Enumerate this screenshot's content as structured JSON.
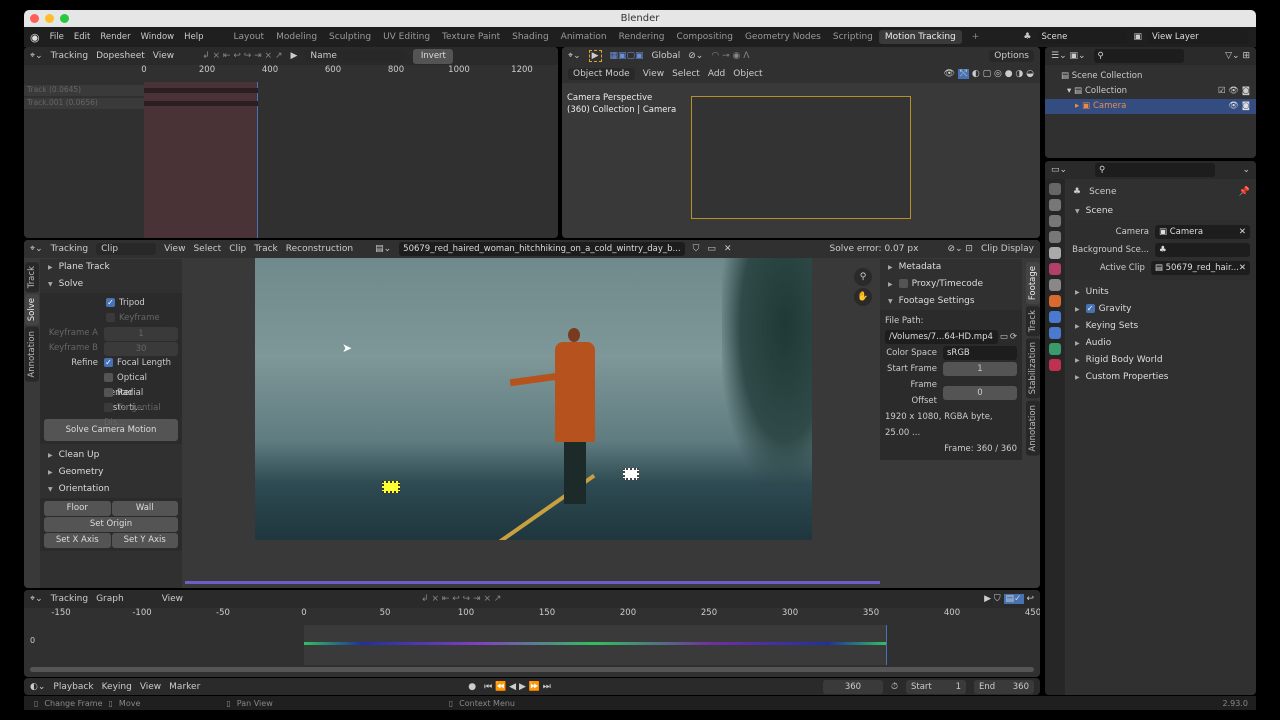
{
  "window": {
    "title": "Blender",
    "version": "2.93.0"
  },
  "menu": [
    "File",
    "Edit",
    "Render",
    "Window",
    "Help"
  ],
  "workspaces": [
    "Layout",
    "Modeling",
    "Sculpting",
    "UV Editing",
    "Texture Paint",
    "Shading",
    "Animation",
    "Rendering",
    "Compositing",
    "Geometry Nodes",
    "Scripting",
    "Motion Tracking"
  ],
  "active_workspace": "Motion Tracking",
  "scene": "Scene",
  "view_layer": "View Layer",
  "dopesheet": {
    "mode": "Tracking",
    "view_type": "Dopesheet",
    "view": "View",
    "sort": "Name",
    "invert": "Invert",
    "ticks": [
      "0",
      "200",
      "400",
      "600",
      "800",
      "1000",
      "1200"
    ],
    "tracks": [
      "Track (0.0645)",
      "Track.001 (0.0656)"
    ]
  },
  "viewport": {
    "mode": "Object Mode",
    "menus": [
      "View",
      "Select",
      "Add",
      "Object"
    ],
    "transform": "Global",
    "options": "Options",
    "info1": "Camera Perspective",
    "info2": "(360) Collection | Camera"
  },
  "outliner": {
    "items": [
      "Scene Collection",
      "Collection",
      "Camera"
    ]
  },
  "properties": {
    "context": "Scene",
    "section": "Scene",
    "camera_label": "Camera",
    "camera": "Camera",
    "bg_label": "Background Sce...",
    "clip_label": "Active Clip",
    "clip": "50679_red_hair...",
    "panels": [
      "Units",
      "Gravity",
      "Keying Sets",
      "Audio",
      "Rigid Body World",
      "Custom Properties"
    ]
  },
  "clip": {
    "mode": "Tracking",
    "view": "Clip",
    "menus": [
      "View",
      "Select",
      "Clip",
      "Track",
      "Reconstruction"
    ],
    "filename": "50679_red_haired_woman_hitchhiking_on_a_cold_wintry_day_b...",
    "solve_error": "Solve error: 0.07 px",
    "display": "Clip Display",
    "tabs": [
      "Track",
      "Solve",
      "Annotation"
    ],
    "plane_track": "Plane Track",
    "solve": "Solve",
    "tripod": "Tripod",
    "keyframe": "Keyframe",
    "keyframe_a_label": "Keyframe A",
    "keyframe_a": "1",
    "keyframe_b_label": "Keyframe B",
    "keyframe_b": "30",
    "refine": "Refine",
    "refine_opts": [
      "Focal Length",
      "Optical Center",
      "Radial Distorti...",
      "Tangential Dis..."
    ],
    "solve_btn": "Solve Camera Motion",
    "clean_up": "Clean Up",
    "geometry": "Geometry",
    "orientation": "Orientation",
    "floor": "Floor",
    "wall": "Wall",
    "set_origin": "Set Origin",
    "set_x": "Set X Axis",
    "set_y": "Set Y Axis",
    "right_tabs": [
      "Footage",
      "Track",
      "Stabilization",
      "Annotation"
    ],
    "metadata": "Metadata",
    "proxy": "Proxy/Timecode",
    "footage": "Footage Settings",
    "file_path_label": "File Path:",
    "file_path": "/Volumes/7...64-HD.mp4",
    "color_space_label": "Color Space",
    "color_space": "sRGB",
    "start_frame_label": "Start Frame",
    "start_frame": "1",
    "frame_offset_label": "Frame Offset",
    "frame_offset": "0",
    "info": "1920 x 1080, RGBA byte, 25.00 ...",
    "frame": "Frame: 360 / 360"
  },
  "graph": {
    "mode": "Tracking",
    "view_type": "Graph",
    "view": "View",
    "ticks": [
      "-150",
      "-100",
      "-50",
      "0",
      "50",
      "100",
      "150",
      "200",
      "250",
      "300",
      "350",
      "400",
      "450"
    ],
    "y_label": "0"
  },
  "timeline": {
    "menus": [
      "Playback",
      "Keying",
      "View",
      "Marker"
    ],
    "current": "360",
    "start_label": "Start",
    "start": "1",
    "end_label": "End",
    "end": "360"
  },
  "status": [
    "Change Frame",
    "Move",
    "Pan View",
    "Context Menu"
  ],
  "colors": {
    "accent": "#4772b3",
    "selected_row": "#334d80",
    "track_range": "#5a3a3d"
  }
}
